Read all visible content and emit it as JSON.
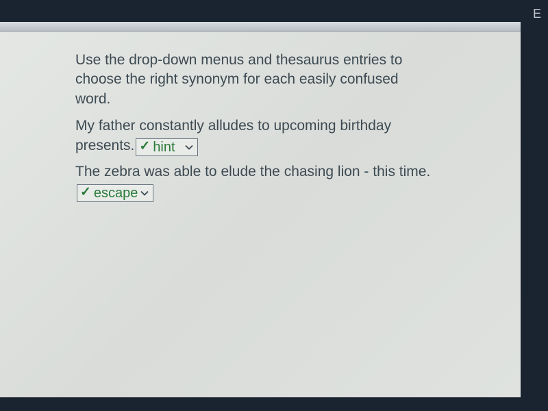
{
  "corner_letter": "E",
  "instruction": "Use the drop-down menus and thesaurus entries to choose the right synonym for each easily confused word.",
  "questions": [
    {
      "text_before": "My father constantly alludes to upcoming birthday presents.",
      "selected": "hint",
      "correct": true
    },
    {
      "text_before": "The zebra was able to elude the chasing lion - this time.",
      "selected": "escape",
      "correct": true
    }
  ]
}
